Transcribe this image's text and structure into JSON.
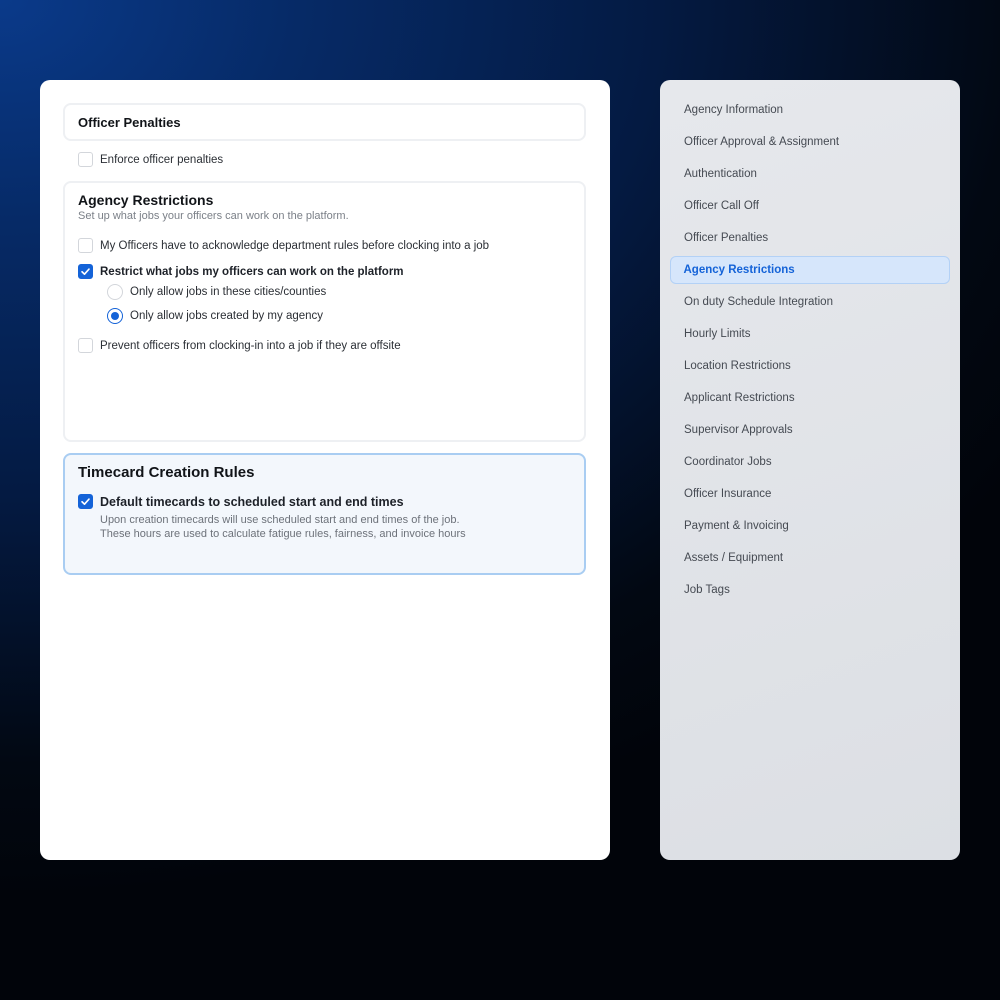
{
  "penalties": {
    "title": "Officer Penalties",
    "enforce_label": "Enforce officer penalties",
    "enforce_checked": false
  },
  "restrictions": {
    "title": "Agency Restrictions",
    "subtitle": "Set up what jobs your officers can work on the platform.",
    "acknowledge_label": "My Officers have to acknowledge department rules before clocking into a job",
    "restrict_label": "Restrict what jobs my officers can work on the platform",
    "radio_cities_label": "Only allow jobs in these cities/counties",
    "radio_agency_label": "Only allow jobs created by my agency",
    "prevent_label": "Prevent officers from clocking-in into a job if they are offsite"
  },
  "timecard": {
    "title": "Timecard Creation Rules",
    "default_label": "Default timecards to scheduled start and end times",
    "desc_line1": "Upon creation timecards will use scheduled start and end times of the job.",
    "desc_line2": "These hours are used to calculate fatigue rules, fairness, and invoice hours"
  },
  "sidebar": {
    "items": [
      {
        "label": "Agency Information"
      },
      {
        "label": "Officer Approval & Assignment"
      },
      {
        "label": "Authentication"
      },
      {
        "label": "Officer Call Off"
      },
      {
        "label": "Officer Penalties"
      },
      {
        "label": "Agency Restrictions",
        "active": true
      },
      {
        "label": "On duty Schedule Integration"
      },
      {
        "label": "Hourly Limits"
      },
      {
        "label": "Location Restrictions"
      },
      {
        "label": "Applicant Restrictions"
      },
      {
        "label": "Supervisor Approvals"
      },
      {
        "label": "Coordinator Jobs"
      },
      {
        "label": "Officer Insurance"
      },
      {
        "label": "Payment & Invoicing"
      },
      {
        "label": "Assets / Equipment"
      },
      {
        "label": "Job Tags"
      }
    ]
  },
  "colors": {
    "accent": "#1463d8",
    "active_bg": "#d6e6fb",
    "timecard_border": "#a9cdf2"
  }
}
